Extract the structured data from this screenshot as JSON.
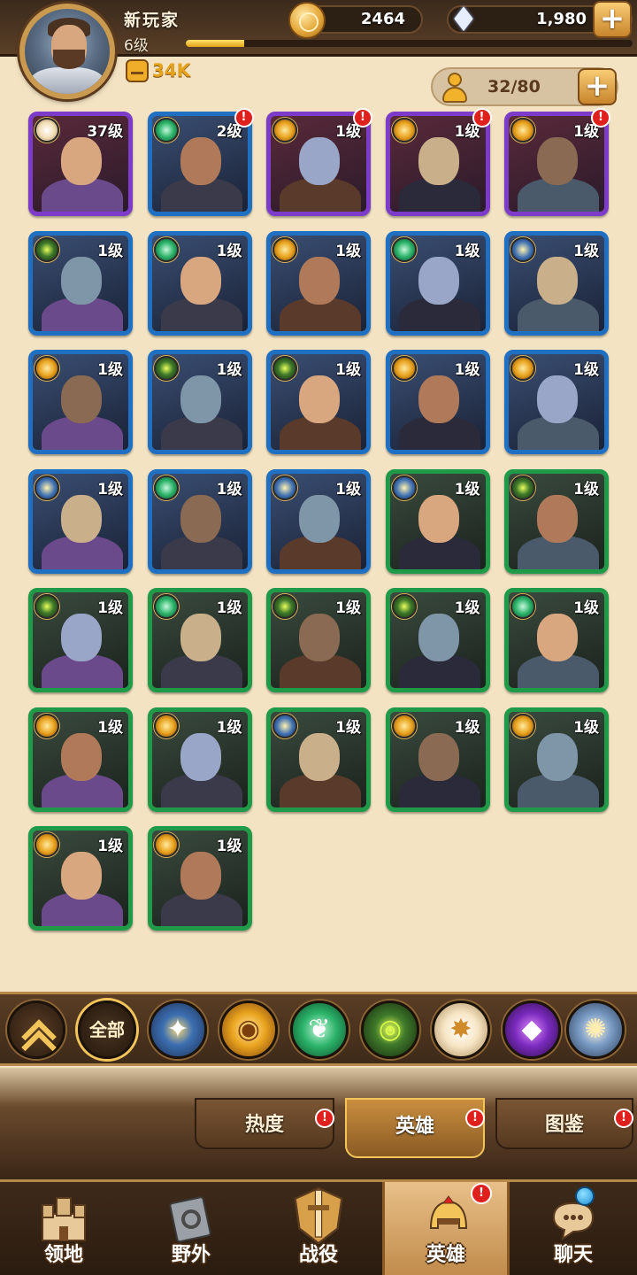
{
  "player": {
    "name": "新玩家",
    "level": "6级",
    "xp_progress": 0.13,
    "power": "34K"
  },
  "resources": {
    "gold": "2464",
    "gems": "1,980"
  },
  "hero_capacity": "32/80",
  "heroes": [
    {
      "level": "37级",
      "rarity": "purple",
      "faction": "celestial",
      "alert": false
    },
    {
      "level": "2级",
      "rarity": "blue",
      "faction": "wilder",
      "alert": true
    },
    {
      "level": "1级",
      "rarity": "purple",
      "faction": "mauler",
      "alert": true
    },
    {
      "level": "1级",
      "rarity": "purple",
      "faction": "mauler",
      "alert": true
    },
    {
      "level": "1级",
      "rarity": "purple",
      "faction": "mauler",
      "alert": true
    },
    {
      "level": "1级",
      "rarity": "blue",
      "faction": "graveborn",
      "alert": false
    },
    {
      "level": "1级",
      "rarity": "blue",
      "faction": "wilder",
      "alert": false
    },
    {
      "level": "1级",
      "rarity": "blue",
      "faction": "mauler",
      "alert": false
    },
    {
      "level": "1级",
      "rarity": "blue",
      "faction": "wilder",
      "alert": false
    },
    {
      "level": "1级",
      "rarity": "blue",
      "faction": "lightbearer",
      "alert": false
    },
    {
      "level": "1级",
      "rarity": "blue",
      "faction": "mauler",
      "alert": false
    },
    {
      "level": "1级",
      "rarity": "blue",
      "faction": "graveborn",
      "alert": false
    },
    {
      "level": "1级",
      "rarity": "blue",
      "faction": "graveborn",
      "alert": false
    },
    {
      "level": "1级",
      "rarity": "blue",
      "faction": "mauler",
      "alert": false
    },
    {
      "level": "1级",
      "rarity": "blue",
      "faction": "mauler",
      "alert": false
    },
    {
      "level": "1级",
      "rarity": "blue",
      "faction": "lightbearer",
      "alert": false
    },
    {
      "level": "1级",
      "rarity": "blue",
      "faction": "wilder",
      "alert": false
    },
    {
      "level": "1级",
      "rarity": "blue",
      "faction": "lightbearer",
      "alert": false
    },
    {
      "level": "1级",
      "rarity": "green",
      "faction": "lightbearer",
      "alert": false
    },
    {
      "level": "1级",
      "rarity": "green",
      "faction": "graveborn",
      "alert": false
    },
    {
      "level": "1级",
      "rarity": "green",
      "faction": "graveborn",
      "alert": false
    },
    {
      "level": "1级",
      "rarity": "green",
      "faction": "wilder",
      "alert": false
    },
    {
      "level": "1级",
      "rarity": "green",
      "faction": "graveborn",
      "alert": false
    },
    {
      "level": "1级",
      "rarity": "green",
      "faction": "graveborn",
      "alert": false
    },
    {
      "level": "1级",
      "rarity": "green",
      "faction": "wilder",
      "alert": false
    },
    {
      "level": "1级",
      "rarity": "green",
      "faction": "mauler",
      "alert": false
    },
    {
      "level": "1级",
      "rarity": "green",
      "faction": "mauler",
      "alert": false
    },
    {
      "level": "1级",
      "rarity": "green",
      "faction": "lightbearer",
      "alert": false
    },
    {
      "level": "1级",
      "rarity": "green",
      "faction": "mauler",
      "alert": false
    },
    {
      "level": "1级",
      "rarity": "green",
      "faction": "mauler",
      "alert": false
    },
    {
      "level": "1级",
      "rarity": "green",
      "faction": "mauler",
      "alert": false
    },
    {
      "level": "1级",
      "rarity": "green",
      "faction": "mauler",
      "alert": false
    }
  ],
  "filters": {
    "all_label": "全部",
    "items": [
      "collapse-icon",
      "lightbearer-icon",
      "mauler-icon",
      "wilder-icon",
      "graveborn-icon",
      "celestial-icon",
      "hypogean-icon",
      "dimensional-icon"
    ]
  },
  "subtabs": [
    {
      "label": "热度",
      "alert": true
    },
    {
      "label": "英雄",
      "alert": true,
      "active": true
    },
    {
      "label": "图鉴",
      "alert": true
    }
  ],
  "bottom_nav": [
    {
      "label": "领地",
      "icon": "castle-icon"
    },
    {
      "label": "野外",
      "icon": "map-scroll-icon"
    },
    {
      "label": "战役",
      "icon": "sword-shield-icon"
    },
    {
      "label": "英雄",
      "icon": "helmet-icon",
      "active": true,
      "alert": true
    },
    {
      "label": "聊天",
      "icon": "chat-icon",
      "notification": true
    }
  ],
  "colors": {
    "rarity_purple": "#7c3bc9",
    "rarity_blue": "#1f6fc2",
    "rarity_green": "#1e9a48",
    "alert_red": "#e0201c",
    "accent_gold": "#f2c45a"
  }
}
